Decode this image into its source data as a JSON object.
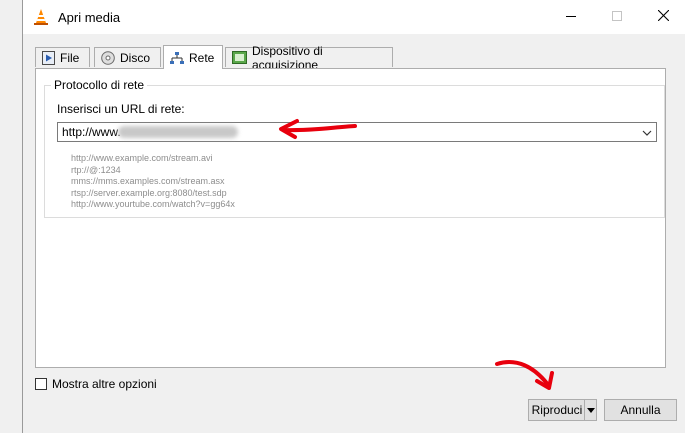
{
  "dialog": {
    "title": "Apri media",
    "window_controls": {
      "minimize": "minimize-icon",
      "maximize": "maximize-icon",
      "close": "close-icon"
    }
  },
  "tabs": [
    {
      "label": "File",
      "icon": "file-play-icon",
      "active": false
    },
    {
      "label": "Disco",
      "icon": "disc-icon",
      "active": false
    },
    {
      "label": "Rete",
      "icon": "network-icon",
      "active": true
    },
    {
      "label": "Dispositivo di acquisizione",
      "icon": "capture-device-icon",
      "active": false
    }
  ],
  "network": {
    "group_title": "Protocollo di rete",
    "url_label": "Inserisci un URL di rete:",
    "url_value": "http://www.",
    "examples": [
      "http://www.example.com/stream.avi",
      "rtp://@:1234",
      "mms://mms.examples.com/stream.asx",
      "rtsp://server.example.org:8080/test.sdp",
      "http://www.yourtube.com/watch?v=gg64x"
    ]
  },
  "footer": {
    "more_options_label": "Mostra altre opzioni",
    "more_options_checked": false,
    "play_label": "Riproduci",
    "cancel_label": "Annulla"
  },
  "colors": {
    "annotation_arrow": "#e8000d",
    "dialog_bg": "#f0f0f0",
    "example_text": "#8d8d8d"
  }
}
